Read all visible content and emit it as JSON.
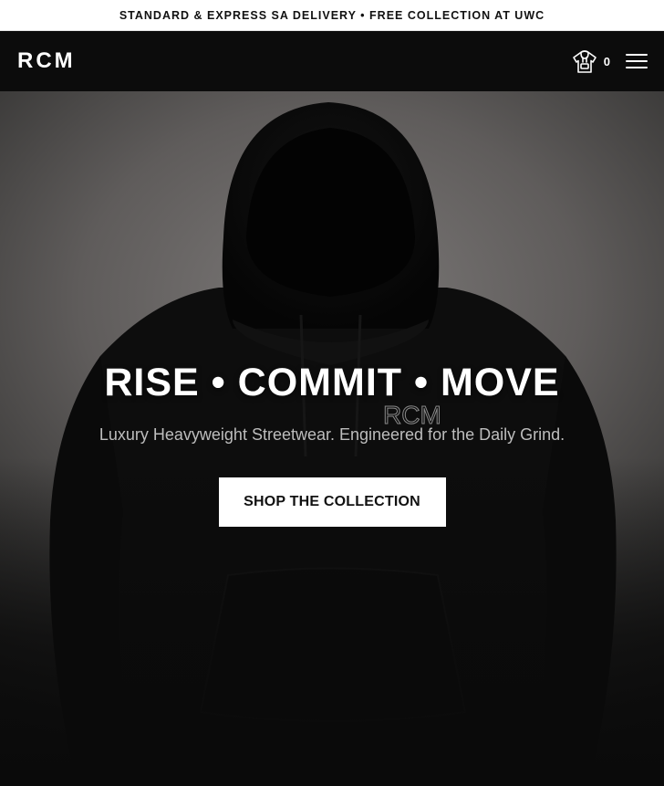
{
  "announcement": {
    "text": "STANDARD & EXPRESS SA DELIVERY • FREE COLLECTION AT UWC"
  },
  "header": {
    "logo": "RCM",
    "cart_count": "0",
    "cart_icon": "hoodie-bag-icon",
    "menu_icon": "hamburger-menu-icon"
  },
  "hero": {
    "title": "RISE • COMMIT • MOVE",
    "subtitle": "Luxury Heavyweight Streetwear. Engineered for the Daily Grind.",
    "cta_label": "SHOP THE COLLECTION",
    "watermark": "RCM"
  },
  "colors": {
    "header_bg": "#0c0c0c",
    "announcement_bg": "#ffffff",
    "cta_bg": "#ffffff",
    "text_primary": "#ffffff"
  }
}
